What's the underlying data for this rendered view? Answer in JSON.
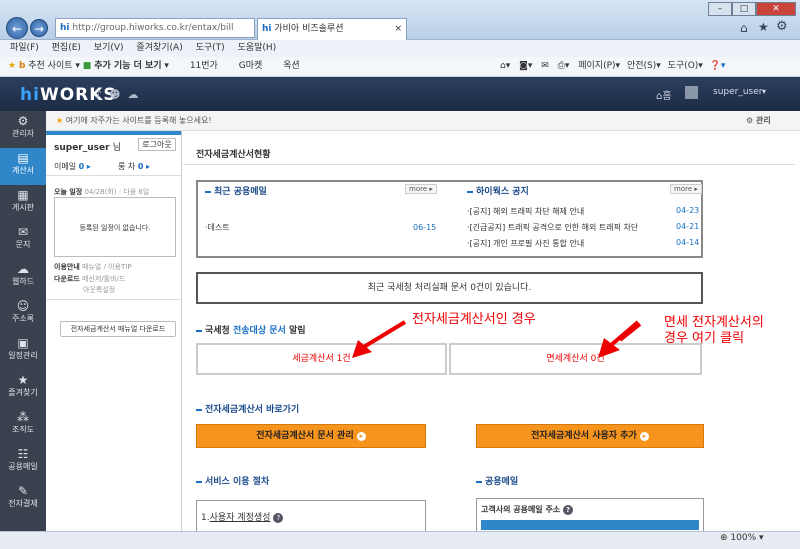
{
  "browser": {
    "address": "http://group.hiworks.co.kr/entax/bill",
    "tab_title": "가비아 비즈솔루션",
    "menu": [
      "파일(F)",
      "편집(E)",
      "보기(V)",
      "즐겨찾기(A)",
      "도구(T)",
      "도움말(H)"
    ],
    "favorites": [
      "추천 사이트",
      "추가 기능 더 보기",
      "11번가",
      "G마켓",
      "옥션"
    ],
    "cmd": [
      "페이지(P)",
      "안전(S)",
      "도구(O)"
    ],
    "zoom": "100%"
  },
  "app": {
    "logo_hi": "hi",
    "logo_works": "WORKS",
    "user": "super_user",
    "notice": "여기에 자주가는 사이트를 등록해 놓으세요!",
    "manage": "관리",
    "nav": [
      "관리자",
      "계산서",
      "게시판",
      "문지",
      "웹하드",
      "주소록",
      "일정관리",
      "즐겨찾기",
      "조직도",
      "공용메일",
      "전자결제"
    ]
  },
  "panel": {
    "username": "super_user",
    "nim": "님",
    "logout": "로그아웃",
    "mail_label": "이메일",
    "mail_count": "0",
    "sms_label": "롱 차",
    "sms_count": "0",
    "today_label": "오늘 일정",
    "today_date": "04/28(화) : 다음 6일",
    "empty_schedule": "등록된 일정이 없습니다.",
    "guide_label": "이용안내",
    "guide_links": "매뉴얼 / 이용TIP",
    "download_label": "다운로드",
    "download_links": "메신저/툴바/드",
    "download_links2": "아웃룩설정",
    "manual_btn": "전자세금계산서 매뉴얼 다운로드"
  },
  "main": {
    "title": "전자세금계산서현황",
    "mail_box_title": "최근 공용메일",
    "more": "more",
    "mail_item": "데스트",
    "mail_date": "06-15",
    "notice_box_title": "하이웍스 공지",
    "notices": [
      {
        "text": "[공지] 해외 트래픽 차단 해제 안내",
        "date": "04-23"
      },
      {
        "text": "[긴급공지] 트래픽 공격으로 인한 해외 트래픽 차단",
        "date": "04-21"
      },
      {
        "text": "[공지] 개인 프로필 사진 통합 안내",
        "date": "04-14"
      }
    ],
    "fail_msg": "최근 국세청 처리실패 문서 0건이 있습니다.",
    "send_pre": "국세청 ",
    "send_em": "전송대상 문서",
    "send_post": " 알림",
    "tax_btn": "세금계산서 1건",
    "free_btn": "면세계산서 0건",
    "shortcut_title": "전자세금계산서 바로가기",
    "doc_mgmt": "전자세금계산서 문서 관리",
    "user_add": "전자세금계산서 사용자 추가",
    "service_title": "서비스 이용 절차",
    "step1": "사용자 계정생성",
    "pubmail_title": "공용메일",
    "pubmail_addr": "고객사의 공용메일 주소",
    "anno1": "전자세금계산서인 경우",
    "anno2a": "면세 전자계산서의",
    "anno2b": "경우 여기 클릭"
  }
}
